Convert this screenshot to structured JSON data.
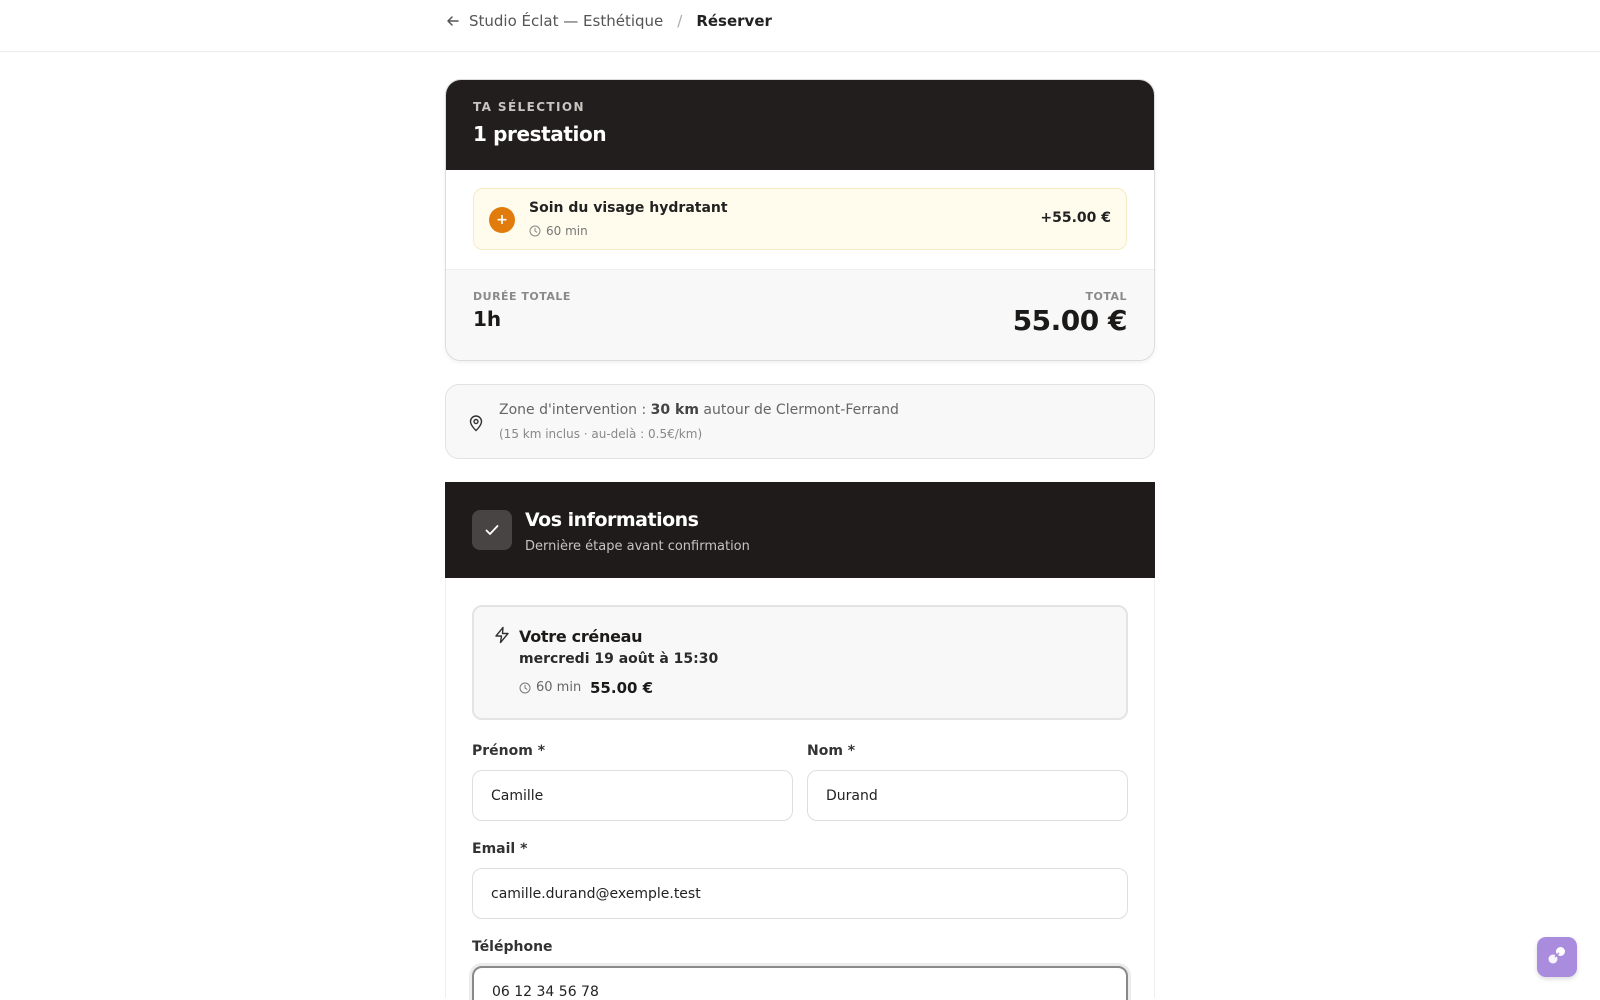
{
  "breadcrumb": {
    "parent": "Studio Éclat — Esthétique",
    "separator": "/",
    "current": "Réserver"
  },
  "summary": {
    "eyebrow": "TA SÉLECTION",
    "title": "1 prestation",
    "services": [
      {
        "name": "Soin du visage hydratant",
        "duration": "60 min",
        "price": "+55.00 €",
        "badge": "+"
      }
    ],
    "duration_label": "DURÉE TOTALE",
    "duration_value": "1h",
    "total_label": "TOTAL",
    "total_value": "55.00 €"
  },
  "zone": {
    "prefix": "Zone d'intervention :",
    "distance": "30 km",
    "suffix": "autour de Clermont-Ferrand",
    "details": "(15 km inclus · au-delà : 0.5€/km)"
  },
  "info": {
    "title": "Vos informations",
    "subtitle": "Dernière étape avant confirmation",
    "slot": {
      "title": "Votre créneau",
      "date": "mercredi 19 août à 15:30",
      "duration": "60 min",
      "price": "55.00 €"
    },
    "fields": {
      "first_name": {
        "label": "Prénom *",
        "value": "Camille"
      },
      "last_name": {
        "label": "Nom *",
        "value": "Durand"
      },
      "email": {
        "label": "Email *",
        "value": "camille.durand@exemple.test"
      },
      "phone": {
        "label": "Téléphone",
        "value": "06 12 34 56 78"
      }
    }
  },
  "colors": {
    "dark": "#211e1d",
    "accent": "#e07b0c",
    "service_bg": "#fffcee",
    "chat": "#a98cde"
  },
  "icons": {
    "back": "arrow-left-icon",
    "clock": "clock-icon",
    "pin": "map-pin-icon",
    "check": "check-icon",
    "bolt": "bolt-icon",
    "chat": "chat-widget-icon"
  }
}
